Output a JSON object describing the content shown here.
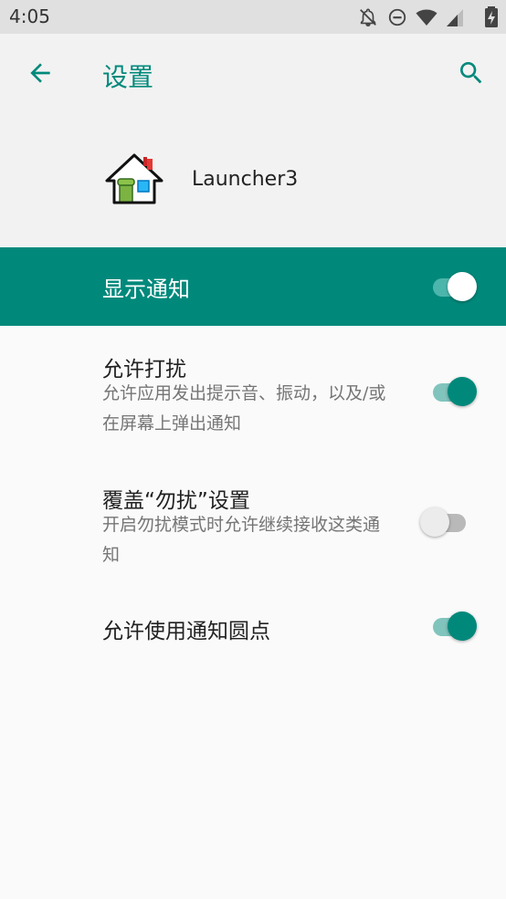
{
  "status_bar": {
    "time": "4:05",
    "icons": [
      "notifications-off-icon",
      "do-not-disturb-icon",
      "wifi-icon",
      "cellular-signal-icon",
      "battery-charging-icon"
    ]
  },
  "app_bar": {
    "title": "设置",
    "back_icon": "arrow-back-icon",
    "search_icon": "search-icon"
  },
  "app_info": {
    "name": "Launcher3",
    "icon": "launcher-house-icon"
  },
  "main_toggle": {
    "label": "显示通知",
    "enabled": true
  },
  "settings": [
    {
      "title": "允许打扰",
      "summary": "允许应用发出提示音、振动，以及/或在屏幕上弹出通知",
      "enabled": true
    },
    {
      "title": "覆盖“勿扰”设置",
      "summary": "开启勿扰模式时允许继续接收这类通知",
      "enabled": false
    },
    {
      "title": "允许使用通知圆点",
      "summary": "",
      "enabled": true
    }
  ],
  "colors": {
    "accent": "#00897b",
    "accent_track": "#80c4bd",
    "off_thumb": "#ececec",
    "off_track": "#b9b9b9",
    "status_bar_bg": "#e0e0e0",
    "app_bar_bg": "#f2f2f2",
    "background": "#fafafa"
  }
}
